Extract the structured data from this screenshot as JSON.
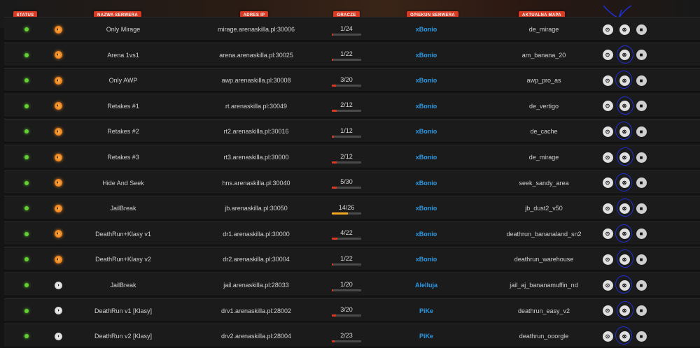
{
  "headers": {
    "status": "STATUS",
    "name": "NAZWA SERWERA",
    "ip": "ADRES IP",
    "players": "GRACZE",
    "owner": "OPIEKUN SERWERA",
    "map": "AKTUALNA MAPA"
  },
  "colors": {
    "accent": "#d93a23",
    "online": "#62d233",
    "owner": "#2a9ae6",
    "annotation": "#1f2fd6"
  },
  "servers": [
    {
      "game": "go",
      "name": "Only Mirage",
      "ip": "mirage.arenaskilla.pl:30006",
      "players": "1/24",
      "fill": 0.04,
      "owner": "xBonio",
      "map": "de_mirage"
    },
    {
      "game": "go",
      "name": "Arena 1vs1",
      "ip": "arena.arenaskilla.pl:30025",
      "players": "1/22",
      "fill": 0.05,
      "owner": "xBonio",
      "map": "am_banana_20"
    },
    {
      "game": "go",
      "name": "Only AWP",
      "ip": "awp.arenaskilla.pl:30008",
      "players": "3/20",
      "fill": 0.15,
      "owner": "xBonio",
      "map": "awp_pro_as"
    },
    {
      "game": "go",
      "name": "Retakes #1",
      "ip": "rt.arenaskilla.pl:30049",
      "players": "2/12",
      "fill": 0.17,
      "owner": "xBonio",
      "map": "de_vertigo"
    },
    {
      "game": "go",
      "name": "Retakes #2",
      "ip": "rt2.arenaskilla.pl:30016",
      "players": "1/12",
      "fill": 0.08,
      "owner": "xBonio",
      "map": "de_cache"
    },
    {
      "game": "go",
      "name": "Retakes #3",
      "ip": "rt3.arenaskilla.pl:30000",
      "players": "2/12",
      "fill": 0.17,
      "owner": "xBonio",
      "map": "de_mirage"
    },
    {
      "game": "go",
      "name": "Hide And Seek",
      "ip": "hns.arenaskilla.pl:30040",
      "players": "5/30",
      "fill": 0.17,
      "owner": "xBonio",
      "map": "seek_sandy_area"
    },
    {
      "game": "go",
      "name": "JailBreak",
      "ip": "jb.arenaskilla.pl:30050",
      "players": "14/26",
      "fill": 0.54,
      "owner": "xBonio",
      "map": "jb_dust2_v50"
    },
    {
      "game": "go",
      "name": "DeathRun+Klasy v1",
      "ip": "dr1.arenaskilla.pl:30000",
      "players": "4/22",
      "fill": 0.18,
      "owner": "xBonio",
      "map": "deathrun_bananaland_sn2"
    },
    {
      "game": "go",
      "name": "DeathRun+Klasy v2",
      "ip": "dr2.arenaskilla.pl:30004",
      "players": "1/22",
      "fill": 0.05,
      "owner": "xBonio",
      "map": "deathrun_warehouse"
    },
    {
      "game": "cs",
      "name": "JailBreak",
      "ip": "jail.arenaskilla.pl:28033",
      "players": "1/20",
      "fill": 0.05,
      "owner": "Alelluja",
      "map": "jail_aj_bananamuffin_nd"
    },
    {
      "game": "cs",
      "name": "DeathRun v1 [Klasy]",
      "ip": "drv1.arenaskilla.pl:28002",
      "players": "3/20",
      "fill": 0.15,
      "owner": "PiKe",
      "map": "deathrun_easy_v2"
    },
    {
      "game": "cs",
      "name": "DeathRun v2 [Klasy]",
      "ip": "drv2.arenaskilla.pl:28004",
      "players": "2/23",
      "fill": 0.09,
      "owner": "PiKe",
      "map": "deathrun_ooorgle"
    }
  ],
  "icons": {
    "steam": "steam-icon",
    "connect": "connect-icon",
    "tv": "video-camera-icon",
    "game_go": "csgo-icon",
    "game_cs": "cs16-icon"
  },
  "glyphs": {
    "steam": "⊙",
    "connect": "⊗",
    "tv": "■",
    "game_go": "◐",
    "game_cs": "◑"
  }
}
